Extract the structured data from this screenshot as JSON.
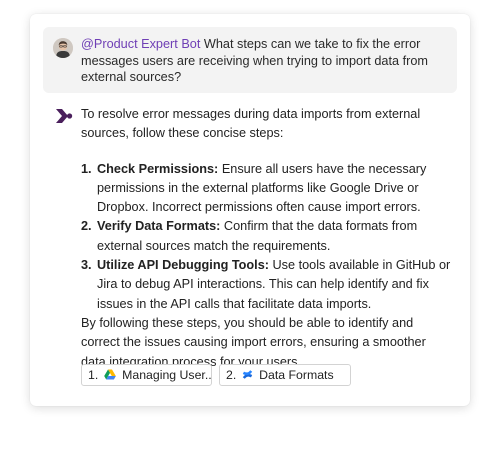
{
  "question": {
    "mention": "@Product Expert Bot",
    "text": " What steps can we take to fix the error messages users are receiving when trying to import data from external sources?"
  },
  "answer": {
    "intro": "To resolve error messages during data imports from external sources, follow these concise steps:",
    "steps": [
      {
        "number": "1.",
        "title": "Check Permissions:",
        "text": " Ensure all users have the necessary permissions in the external platforms like Google Drive or Dropbox. Incorrect permissions often cause import errors."
      },
      {
        "number": "2.",
        "title": "Verify Data Formats:",
        "text": " Confirm that the data formats from external sources match the requirements."
      },
      {
        "number": "3.",
        "title": "Utilize API Debugging Tools:",
        "text": " Use tools available in GitHub or Jira to debug API interactions. This can help identify and fix issues in the API calls that facilitate data imports."
      }
    ],
    "conclusion": "By following these steps, you should be able to identify and correct the issues causing import errors, ensuring a smoother data integration process for your users."
  },
  "sources": [
    {
      "number": "1.",
      "icon": "google-drive-icon",
      "label": "Managing User..."
    },
    {
      "number": "2.",
      "icon": "confluence-icon",
      "label": "Data Formats"
    }
  ],
  "colors": {
    "mention": "#6f3fb5",
    "bot_logo": "#4a1f5c",
    "question_bg": "#f3f3f3"
  }
}
